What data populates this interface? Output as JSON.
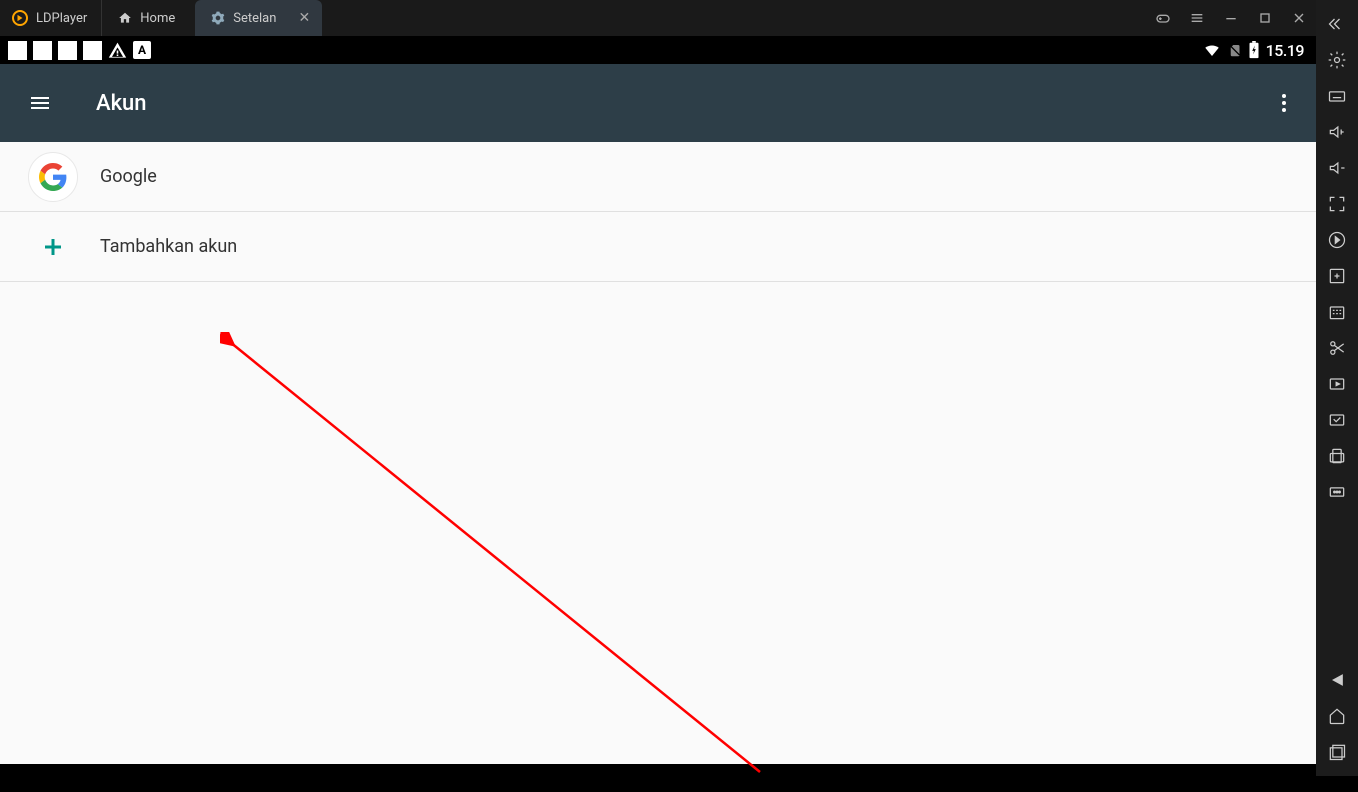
{
  "titlebar": {
    "app_name": "LDPlayer",
    "tabs": [
      {
        "label": "Home"
      },
      {
        "label": "Setelan"
      }
    ]
  },
  "statusbar": {
    "indicator_a": "A",
    "time": "15.19"
  },
  "settings": {
    "page_title": "Akun",
    "rows": [
      {
        "label": "Google"
      },
      {
        "label": "Tambahkan akun"
      }
    ]
  }
}
